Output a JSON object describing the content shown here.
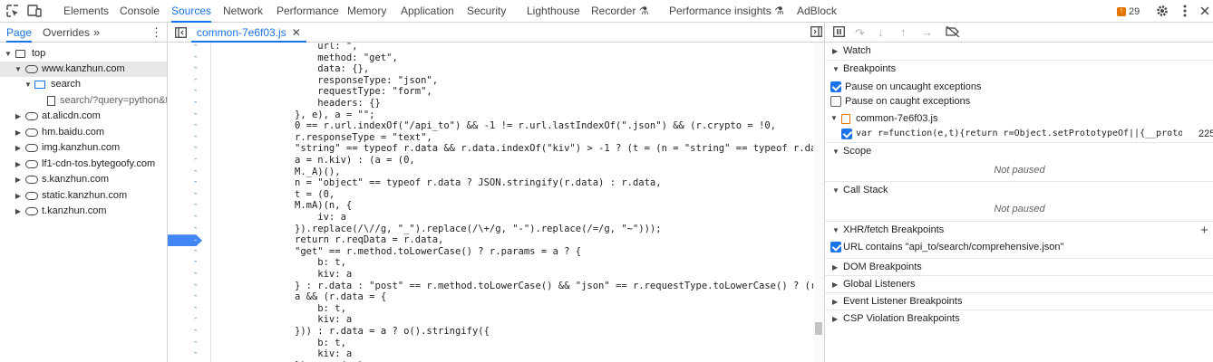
{
  "toolbar": {
    "tabs": [
      "Elements",
      "Console",
      "Sources",
      "Network",
      "Performance",
      "Memory",
      "Application",
      "Security",
      "Lighthouse",
      "Recorder",
      "Performance insights",
      "AdBlock"
    ],
    "issues_count": "29"
  },
  "navigator": {
    "tabs": [
      "Page",
      "Overrides"
    ],
    "tree": [
      "top",
      "www.kanzhun.com",
      "search",
      "search/?query=python&t",
      "at.alicdn.com",
      "hm.baidu.com",
      "img.kanzhun.com",
      "lf1-cdn-tos.bytegoofy.com",
      "s.kanzhun.com",
      "static.kanzhun.com",
      "t.kanzhun.com"
    ]
  },
  "editor": {
    "file_tab": "common-7e6f03.js",
    "breakpoint_marker": "-",
    "code_lines": [
      "    url: \",",
      "    method: \"get\",",
      "    data: {},",
      "    responseType: \"json\",",
      "    requestType: \"form\",",
      "    headers: {}",
      "}, e), a = \"\";",
      "0 == r.url.indexOf(\"/api_to\") && -1 != r.url.lastIndexOf(\".json\") && (r.crypto = !0,",
      "r.responseType = \"text\",",
      "\"string\" == typeof r.data && r.data.indexOf(\"kiv\") > -1 ? (t = (n = \"string\" == typeof r.data ? JSO",
      "a = n.kiv) : (a = (0,",
      "M._A)(),",
      "n = \"object\" == typeof r.data ? JSON.stringify(r.data) : r.data,",
      "t = (0,",
      "M.mA)(n, {",
      "    iv: a",
      "}).replace(/\\//g, \"_\").replace(/\\+/g, \"-\").replace(/=/g, \"~\")));",
      "return r.reqData = r.data,",
      "\"get\" == r.method.toLowerCase() ? r.params = a ? {",
      "    b: t,",
      "    kiv: a",
      "} : r.data : \"post\" == r.method.toLowerCase() && \"json\" == r.requestType.toLowerCase() ? (r.headers",
      "a && (r.data = {",
      "    b: t,",
      "    kiv: a",
      "})) : r.data = a ? o().stringify({",
      "    b: t,",
      "    kiv: a",
      "}) : ...(..)..."
    ]
  },
  "debugger": {
    "watch": "Watch",
    "breakpoints": "Breakpoints",
    "pause_uncaught": "Pause on uncaught exceptions",
    "pause_caught": "Pause on caught exceptions",
    "bp_file": "common-7e6f03.js",
    "bp_code": "var r=function(e,t){return r=Object.setPrototypeOf||{__proto__...",
    "bp_line": "225",
    "scope": "Scope",
    "not_paused_1": "Not paused",
    "call_stack": "Call Stack",
    "not_paused_2": "Not paused",
    "xhr": "XHR/fetch Breakpoints",
    "xhr_rule": "URL contains \"api_to/search/comprehensive.json\"",
    "dom": "DOM Breakpoints",
    "global": "Global Listeners",
    "event": "Event Listener Breakpoints",
    "csp": "CSP Violation Breakpoints"
  }
}
